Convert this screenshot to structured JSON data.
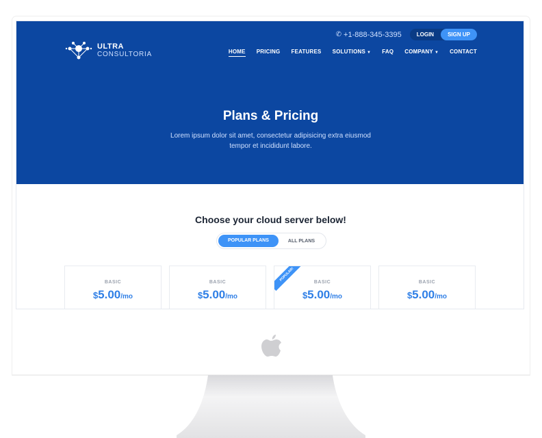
{
  "brand": {
    "name": "ULTRA",
    "tagline": "CONSULTORIA"
  },
  "topbar": {
    "phone": "+1-888-345-3395",
    "login": "LOGIN",
    "signup": "SIGN UP"
  },
  "nav": {
    "items": [
      "HOME",
      "PRICING",
      "FEATURES",
      "SOLUTIONS",
      "FAQ",
      "COMPANY",
      "CONTACT"
    ],
    "active": "HOME"
  },
  "hero": {
    "title": "Plans & Pricing",
    "subtitle": "Lorem ipsum dolor sit amet, consectetur adipisicing extra eiusmod tempor et incididunt labore."
  },
  "pricing": {
    "heading": "Choose your cloud server below!",
    "toggle": {
      "popular": "POPULAR PLANS",
      "all": "ALL PLANS"
    },
    "plans": [
      {
        "name": "BASIC",
        "currency": "$",
        "price": "5.00",
        "period": "/mo",
        "ribbon": ""
      },
      {
        "name": "BASIC",
        "currency": "$",
        "price": "5.00",
        "period": "/mo",
        "ribbon": ""
      },
      {
        "name": "BASIC",
        "currency": "$",
        "price": "5.00",
        "period": "/mo",
        "ribbon": "POPULAR!"
      },
      {
        "name": "BASIC",
        "currency": "$",
        "price": "5.00",
        "period": "/mo",
        "ribbon": ""
      }
    ]
  },
  "icons": {
    "logo": "network-logo-icon",
    "phone": "phone-icon",
    "caret": "chevron-down-icon",
    "device": "apple-logo-icon"
  },
  "colors": {
    "hero": "#0c47a1",
    "accent": "#3e93f7",
    "price": "#2f7fe6"
  }
}
